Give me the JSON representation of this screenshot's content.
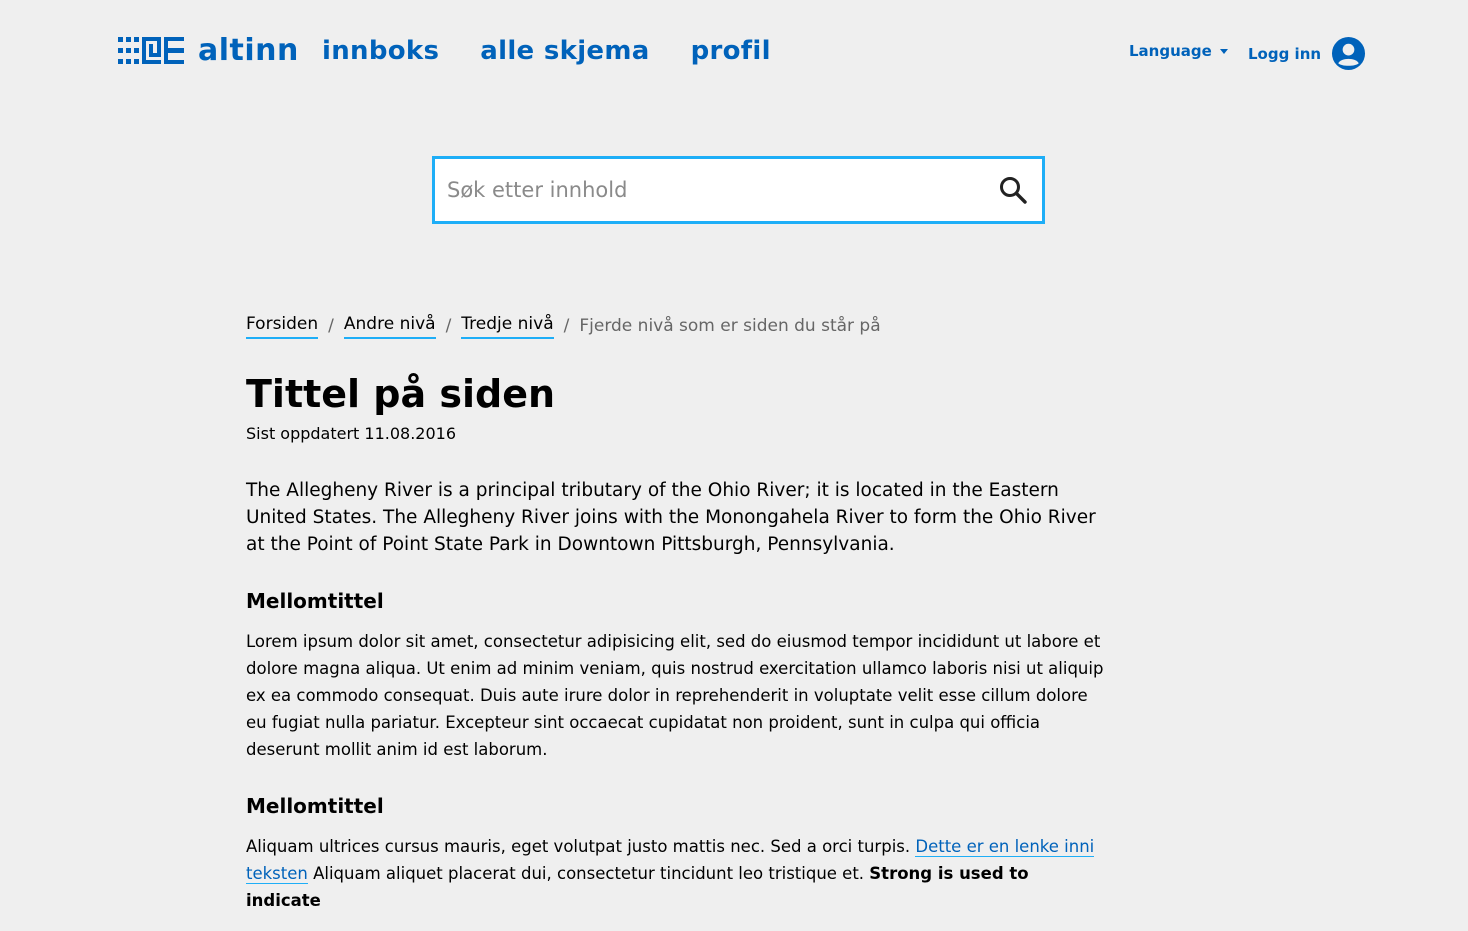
{
  "header": {
    "logo_text": "altinn",
    "nav": [
      {
        "label": "innboks"
      },
      {
        "label": "alle skjema"
      },
      {
        "label": "profil"
      }
    ],
    "language_label": "Language",
    "login_label": "Logg inn"
  },
  "search": {
    "placeholder": "Søk etter innhold"
  },
  "breadcrumb": {
    "items": [
      "Forsiden",
      "Andre nivå",
      "Tredje nivå"
    ],
    "separator": "/",
    "current": "Fjerde nivå som er siden du står på"
  },
  "page": {
    "title": "Tittel på siden",
    "updated": "Sist oppdatert 11.08.2016",
    "lead": "The Allegheny River is a principal tributary of the Ohio River; it is located in the Eastern United States. The Allegheny River joins with the Monongahela River to form the Ohio River at the Point of Point State Park in Downtown Pittsburgh, Pennsylvania.",
    "section1": {
      "heading": "Mellomtittel",
      "text": "Lorem ipsum dolor sit amet, consectetur adipisicing elit, sed do eiusmod tempor incididunt ut labore et dolore magna aliqua. Ut enim ad minim veniam, quis nostrud exercitation ullamco laboris nisi ut aliquip ex ea commodo consequat. Duis aute irure dolor in reprehenderit in voluptate velit esse cillum dolore eu fugiat nulla pariatur. Excepteur sint occaecat cupidatat non proident, sunt in culpa qui officia deserunt mollit anim id est laborum."
    },
    "section2": {
      "heading": "Mellomtittel",
      "text_before": "Aliquam ultrices cursus mauris, eget volutpat justo mattis nec. Sed a orci turpis. ",
      "link_text": "Dette er en lenke inni teksten",
      "text_after": " Aliquam aliquet placerat dui, consectetur tincidunt leo tristique et. ",
      "strong_text": "Strong is used to indicate"
    }
  },
  "colors": {
    "brand": "#0062ba",
    "accent": "#1eaef7",
    "background": "#efefef"
  }
}
